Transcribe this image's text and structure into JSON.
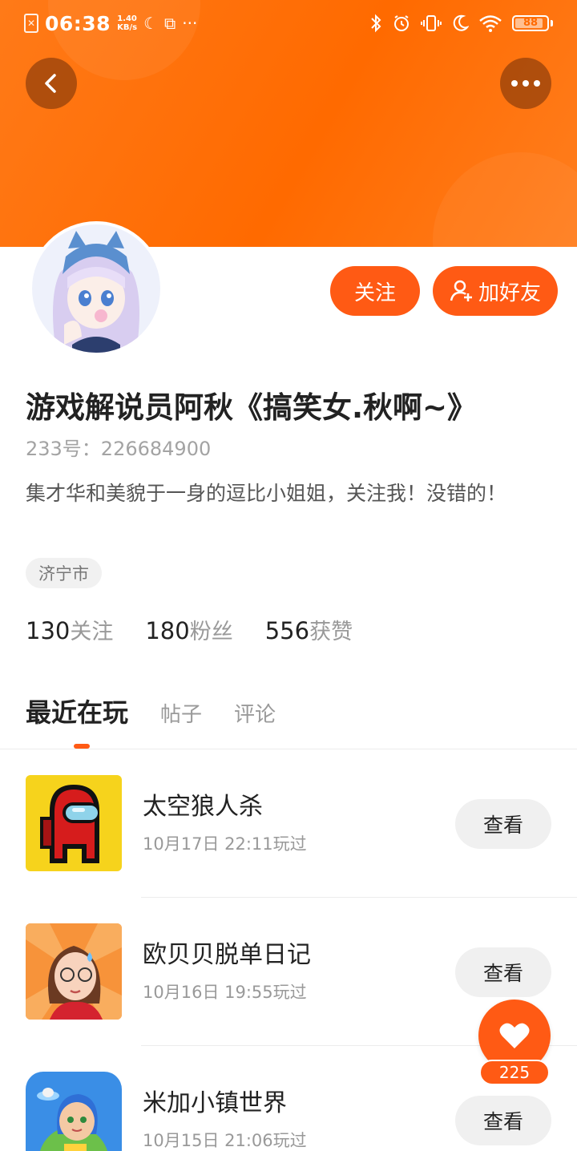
{
  "status_bar": {
    "time": "06:38",
    "speed_value": "1.40",
    "speed_unit": "KB/s",
    "battery": "88",
    "more_dots": "···"
  },
  "profile": {
    "nickname": "游戏解说员阿秋《搞笑女.秋啊~》",
    "uid": "233号：226684900",
    "bio": "集才华和美貌于一身的逗比小姐姐，关注我！没错的！",
    "city": "济宁市"
  },
  "actions": {
    "follow_label": "关注",
    "add_friend_label": "加好友"
  },
  "stats": [
    {
      "num": "130",
      "label": "关注"
    },
    {
      "num": "180",
      "label": "粉丝"
    },
    {
      "num": "556",
      "label": "获赞"
    }
  ],
  "tabs": [
    {
      "label": "最近在玩",
      "active": true
    },
    {
      "label": "帖子",
      "active": false
    },
    {
      "label": "评论",
      "active": false
    }
  ],
  "games": [
    {
      "name": "太空狼人杀",
      "played": "10月17日 22:11玩过",
      "button": "查看"
    },
    {
      "name": "欧贝贝脱单日记",
      "played": "10月16日 19:55玩过",
      "button": "查看"
    },
    {
      "name": "米加小镇世界",
      "played": "10月15日 21:06玩过",
      "button": "查看"
    }
  ],
  "like": {
    "count": "225"
  },
  "colors": {
    "accent": "#ff5a14",
    "header_orange": "#ff6a00"
  }
}
